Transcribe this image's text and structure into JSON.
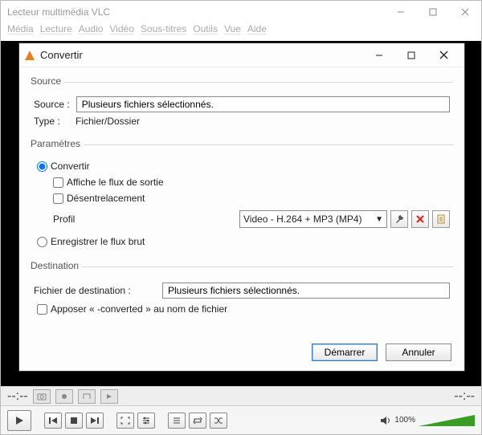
{
  "mainWindow": {
    "title": "Lecteur multimédia VLC",
    "menu": {
      "media": "Média",
      "lecture": "Lecture",
      "audio": "Audio",
      "video": "Vidéo",
      "soustitres": "Sous-titres",
      "outils": "Outils",
      "vue": "Vue",
      "aide": "Aide"
    },
    "status": {
      "dashes": "--:--"
    },
    "volume": {
      "percent": "100%"
    }
  },
  "dialog": {
    "title": "Convertir",
    "source": {
      "legend": "Source",
      "sourceLabel": "Source :",
      "sourceValue": "Plusieurs fichiers sélectionnés.",
      "typeLabel": "Type :",
      "typeValue": "Fichier/Dossier"
    },
    "params": {
      "legend": "Paramètres",
      "convertLabel": "Convertir",
      "showOutputLabel": "Affiche le flux de sortie",
      "deinterlaceLabel": "Désentrelacement",
      "profileLabel": "Profil",
      "profileValue": "Video - H.264 + MP3 (MP4)",
      "rawLabel": "Enregistrer le flux brut"
    },
    "destination": {
      "legend": "Destination",
      "fileLabel": "Fichier de destination :",
      "fileValue": "Plusieurs fichiers sélectionnés.",
      "appendLabel": "Apposer « -converted » au nom de fichier"
    },
    "buttons": {
      "start": "Démarrer",
      "cancel": "Annuler"
    }
  }
}
